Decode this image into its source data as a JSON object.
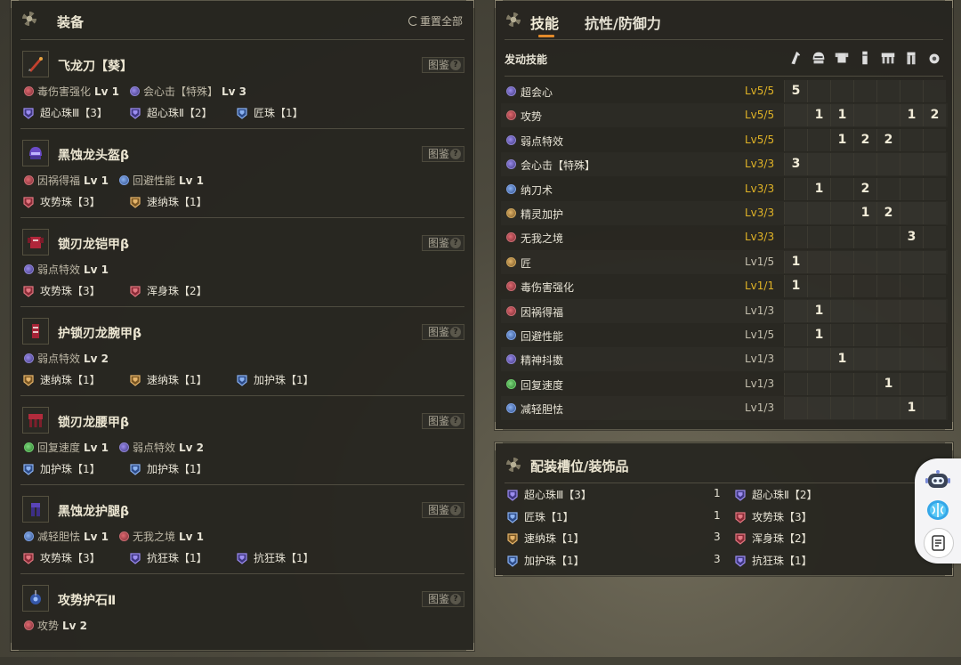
{
  "equipment": {
    "title": "装备",
    "reset_label": "重置全部",
    "tujian_label": "图鉴",
    "help_glyph": "?",
    "items": [
      {
        "name": "飞龙刀【葵】",
        "icon": "weapon-icon",
        "skills": [
          {
            "name": "毒伤害强化",
            "level": "Lv 1",
            "color": "red"
          },
          {
            "name": "会心击【特殊】",
            "level": "Lv 3",
            "color": "purple"
          }
        ],
        "decorations": [
          {
            "name": "超心珠Ⅲ【3】",
            "color": "purple"
          },
          {
            "name": "超心珠Ⅱ【2】",
            "color": "purple"
          },
          {
            "name": "匠珠【1】",
            "color": "blue"
          }
        ]
      },
      {
        "name": "黑蚀龙头盔β",
        "icon": "helm-icon",
        "skills": [
          {
            "name": "因祸得福",
            "level": "Lv 1",
            "color": "red"
          },
          {
            "name": "回避性能",
            "level": "Lv 1",
            "color": "blue"
          }
        ],
        "decorations": [
          {
            "name": "攻势珠【3】",
            "color": "red"
          },
          {
            "name": "速纳珠【1】",
            "color": "orange"
          }
        ]
      },
      {
        "name": "锁刃龙铠甲β",
        "icon": "chest-icon",
        "skills": [
          {
            "name": "弱点特效",
            "level": "Lv 1",
            "color": "purple"
          }
        ],
        "decorations": [
          {
            "name": "攻势珠【3】",
            "color": "red"
          },
          {
            "name": "浑身珠【2】",
            "color": "red"
          }
        ]
      },
      {
        "name": "护锁刃龙腕甲β",
        "icon": "arms-icon",
        "skills": [
          {
            "name": "弱点特效",
            "level": "Lv 2",
            "color": "purple"
          }
        ],
        "decorations": [
          {
            "name": "速纳珠【1】",
            "color": "orange"
          },
          {
            "name": "速纳珠【1】",
            "color": "orange"
          },
          {
            "name": "加护珠【1】",
            "color": "blue"
          }
        ]
      },
      {
        "name": "锁刃龙腰甲β",
        "icon": "waist-icon",
        "skills": [
          {
            "name": "回复速度",
            "level": "Lv 1",
            "color": "green"
          },
          {
            "name": "弱点特效",
            "level": "Lv 2",
            "color": "purple"
          }
        ],
        "decorations": [
          {
            "name": "加护珠【1】",
            "color": "blue"
          },
          {
            "name": "加护珠【1】",
            "color": "blue"
          }
        ]
      },
      {
        "name": "黑蚀龙护腿β",
        "icon": "legs-icon",
        "skills": [
          {
            "name": "减轻胆怯",
            "level": "Lv 1",
            "color": "blue"
          },
          {
            "name": "无我之境",
            "level": "Lv 1",
            "color": "red"
          }
        ],
        "decorations": [
          {
            "name": "攻势珠【3】",
            "color": "red"
          },
          {
            "name": "抗狂珠【1】",
            "color": "purple"
          },
          {
            "name": "抗狂珠【1】",
            "color": "purple"
          }
        ]
      },
      {
        "name": "攻势护石Ⅱ",
        "icon": "charm-icon",
        "skills": [
          {
            "name": "攻势",
            "level": "Lv 2",
            "color": "red"
          }
        ],
        "decorations": []
      }
    ]
  },
  "skills_panel": {
    "tabs": [
      "技能",
      "抗性/防御力"
    ],
    "active_tab": 0,
    "subtitle": "发动技能",
    "armor_column_icons": [
      "weapon-icon",
      "helm-icon",
      "chest-icon",
      "arms-icon",
      "waist-icon",
      "legs-icon",
      "charm-icon"
    ],
    "rows": [
      {
        "name": "超会心",
        "level": "Lv5/5",
        "maxed": true,
        "color": "purple",
        "cells": [
          "5",
          "",
          "",
          "",
          "",
          "",
          ""
        ]
      },
      {
        "name": "攻势",
        "level": "Lv5/5",
        "maxed": true,
        "color": "red",
        "cells": [
          "",
          "1",
          "1",
          "",
          "",
          "1",
          "2"
        ]
      },
      {
        "name": "弱点特效",
        "level": "Lv5/5",
        "maxed": true,
        "color": "purple",
        "cells": [
          "",
          "",
          "1",
          "2",
          "2",
          "",
          ""
        ]
      },
      {
        "name": "会心击【特殊】",
        "level": "Lv3/3",
        "maxed": true,
        "color": "purple",
        "cells": [
          "3",
          "",
          "",
          "",
          "",
          "",
          ""
        ]
      },
      {
        "name": "纳刀术",
        "level": "Lv3/3",
        "maxed": true,
        "color": "blue",
        "cells": [
          "",
          "1",
          "",
          "2",
          "",
          "",
          ""
        ]
      },
      {
        "name": "精灵加护",
        "level": "Lv3/3",
        "maxed": true,
        "color": "orange",
        "cells": [
          "",
          "",
          "",
          "1",
          "2",
          "",
          ""
        ]
      },
      {
        "name": "无我之境",
        "level": "Lv3/3",
        "maxed": true,
        "color": "red",
        "cells": [
          "",
          "",
          "",
          "",
          "",
          "3",
          ""
        ]
      },
      {
        "name": "匠",
        "level": "Lv1/5",
        "maxed": false,
        "color": "orange",
        "cells": [
          "1",
          "",
          "",
          "",
          "",
          "",
          ""
        ]
      },
      {
        "name": "毒伤害强化",
        "level": "Lv1/1",
        "maxed": true,
        "color": "red",
        "cells": [
          "1",
          "",
          "",
          "",
          "",
          "",
          ""
        ]
      },
      {
        "name": "因祸得福",
        "level": "Lv1/3",
        "maxed": false,
        "color": "red",
        "cells": [
          "",
          "1",
          "",
          "",
          "",
          "",
          ""
        ]
      },
      {
        "name": "回避性能",
        "level": "Lv1/5",
        "maxed": false,
        "color": "blue",
        "cells": [
          "",
          "1",
          "",
          "",
          "",
          "",
          ""
        ]
      },
      {
        "name": "精神抖擞",
        "level": "Lv1/3",
        "maxed": false,
        "color": "purple",
        "cells": [
          "",
          "",
          "1",
          "",
          "",
          "",
          ""
        ]
      },
      {
        "name": "回复速度",
        "level": "Lv1/3",
        "maxed": false,
        "color": "green",
        "cells": [
          "",
          "",
          "",
          "",
          "1",
          "",
          ""
        ]
      },
      {
        "name": "减轻胆怯",
        "level": "Lv1/3",
        "maxed": false,
        "color": "blue",
        "cells": [
          "",
          "",
          "",
          "",
          "",
          "1",
          ""
        ]
      }
    ]
  },
  "decorations_panel": {
    "title": "配装槽位/装饰品",
    "left": [
      {
        "name": "超心珠Ⅲ【3】",
        "count": "1",
        "color": "purple"
      },
      {
        "name": "匠珠【1】",
        "count": "1",
        "color": "blue"
      },
      {
        "name": "速纳珠【1】",
        "count": "3",
        "color": "orange"
      },
      {
        "name": "加护珠【1】",
        "count": "3",
        "color": "blue"
      }
    ],
    "right": [
      {
        "name": "超心珠Ⅱ【2】",
        "color": "purple"
      },
      {
        "name": "攻势珠【3】",
        "color": "red"
      },
      {
        "name": "浑身珠【2】",
        "color": "red"
      },
      {
        "name": "抗狂珠【1】",
        "color": "purple"
      }
    ]
  },
  "floating_widget": {
    "buttons": [
      "robot-icon",
      "brain-icon",
      "notes-icon"
    ]
  }
}
